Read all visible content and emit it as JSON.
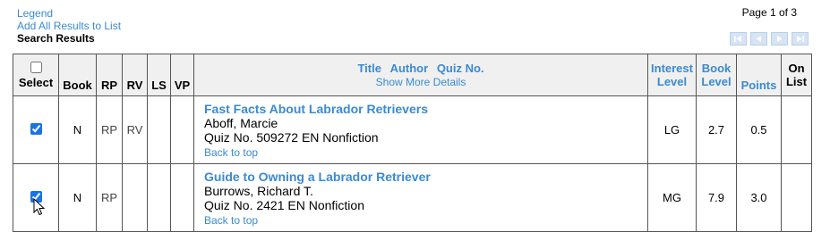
{
  "links": {
    "legend": "Legend",
    "add_all": "Add All Results to List",
    "heading": "Search Results"
  },
  "pagination": {
    "page_text": "Page 1 of 3",
    "buttons": [
      "first-page-icon",
      "prev-page-icon",
      "next-page-icon",
      "last-page-icon"
    ]
  },
  "table": {
    "headers": {
      "select": "Select",
      "book": "Book",
      "rp": "RP",
      "rv": "RV",
      "ls": "LS",
      "vp": "VP",
      "title": "Title",
      "author": "Author",
      "quiz_no": "Quiz No.",
      "show_more": "Show More Details",
      "interest_level": "Interest Level",
      "book_level": "Book Level",
      "points": "Points",
      "on_list": "On List"
    },
    "rows": [
      {
        "checked": true,
        "book": "N",
        "rp": "RP",
        "rv": "RV",
        "ls": "",
        "vp": "",
        "title": "Fast Facts About Labrador Retrievers",
        "author": "Aboff, Marcie",
        "quiz": "Quiz No. 509272 EN Nonfiction",
        "back_to_top": "Back to top",
        "interest_level": "LG",
        "book_level": "2.7",
        "points": "0.5",
        "on_list": ""
      },
      {
        "checked": true,
        "book": "N",
        "rp": "RP",
        "rv": "",
        "ls": "",
        "vp": "",
        "title": "Guide to Owning a Labrador Retriever",
        "author": "Burrows, Richard T.",
        "quiz": "Quiz No. 2421 EN Nonfiction",
        "back_to_top": "Back to top",
        "interest_level": "MG",
        "book_level": "7.9",
        "points": "3.0",
        "on_list": ""
      }
    ]
  },
  "colors": {
    "link": "#3a8ad2",
    "header_bg": "#f0f0f0",
    "pager_bg": "#d7e4f3"
  }
}
